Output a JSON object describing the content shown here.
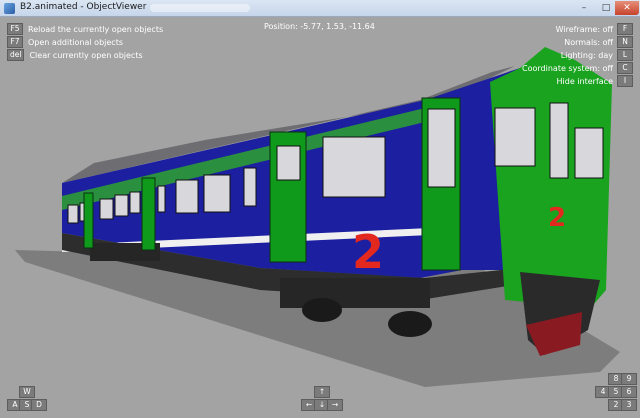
{
  "window": {
    "title": "B2.animated - ObjectViewer"
  },
  "titlebar": {
    "minimize": "–",
    "maximize": "□",
    "close": "✕"
  },
  "hud": {
    "left": [
      {
        "key": "F5",
        "label": "Reload the currently open objects"
      },
      {
        "key": "F7",
        "label": "Open additional objects"
      },
      {
        "key": "del",
        "label": "Clear currently open objects"
      }
    ],
    "position": "Position: -5.77, 1.53, -11.64",
    "right": [
      {
        "label": "Wireframe: off",
        "key": "F"
      },
      {
        "label": "Normals: off",
        "key": "N"
      },
      {
        "label": "Lighting: day",
        "key": "L"
      },
      {
        "label": "Coordinate system: off",
        "key": "C"
      },
      {
        "label": "Hide interface",
        "key": "I"
      }
    ]
  },
  "nav": {
    "wasd": {
      "w": "W",
      "a": "A",
      "s": "S",
      "d": "D"
    },
    "arrows": {
      "up": "↑",
      "left": "←",
      "down": "↓",
      "right": "→"
    },
    "numpad": {
      "n8": "8",
      "n9": "9",
      "n4": "4",
      "n5": "5",
      "n6": "6",
      "n2": "2",
      "n3": "3"
    }
  }
}
